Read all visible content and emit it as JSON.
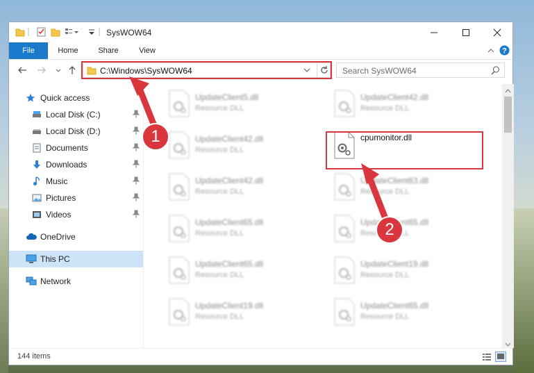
{
  "window": {
    "title": "SysWOW64",
    "caption": {
      "minimize": "minimize",
      "maximize": "maximize",
      "close": "close"
    }
  },
  "ribbon": {
    "tabs": [
      {
        "label": "File",
        "active": true
      },
      {
        "label": "Home"
      },
      {
        "label": "Share"
      },
      {
        "label": "View"
      }
    ]
  },
  "nav": {
    "address": "C:\\Windows\\SysWOW64",
    "search_placeholder": "Search SysWOW64"
  },
  "sidebar": {
    "quick_access": "Quick access",
    "items": [
      {
        "label": "Local Disk (C:)",
        "icon": "drive-icon",
        "pinned": true
      },
      {
        "label": "Local Disk (D:)",
        "icon": "drive-icon",
        "pinned": true
      },
      {
        "label": "Documents",
        "icon": "documents-icon",
        "pinned": true
      },
      {
        "label": "Downloads",
        "icon": "downloads-icon",
        "pinned": true
      },
      {
        "label": "Music",
        "icon": "music-icon",
        "pinned": true
      },
      {
        "label": "Pictures",
        "icon": "pictures-icon",
        "pinned": true
      },
      {
        "label": "Videos",
        "icon": "videos-icon",
        "pinned": true
      }
    ],
    "onedrive": "OneDrive",
    "this_pc": "This PC",
    "network": "Network"
  },
  "files": [
    {
      "name": "UpdateClient5.dll",
      "type": "Resource DLL",
      "blurred": true
    },
    {
      "name": "UpdateClient42.dll",
      "type": "Resource DLL",
      "blurred": true
    },
    {
      "name": "UpdateClient42.dll",
      "type": "Resource DLL",
      "blurred": true
    },
    {
      "name": "cpumonitor.dll",
      "type": "",
      "blurred": false
    },
    {
      "name": "UpdateClient42.dll",
      "type": "Resource DLL",
      "blurred": true
    },
    {
      "name": "UpdateClient63.dll",
      "type": "Resource DLL",
      "blurred": true
    },
    {
      "name": "UpdateClient65.dll",
      "type": "Resource DLL",
      "blurred": true
    },
    {
      "name": "UpdateClient65.dll",
      "type": "Resource DLL",
      "blurred": true
    },
    {
      "name": "UpdateClient65.dll",
      "type": "Resource DLL",
      "blurred": true
    },
    {
      "name": "UpdateClient19.dll",
      "type": "Resource DLL",
      "blurred": true
    },
    {
      "name": "UpdateClient19.dll",
      "type": "Resource DLL",
      "blurred": true
    },
    {
      "name": "UpdateClient65.dll",
      "type": "Resource DLL",
      "blurred": true
    }
  ],
  "status": {
    "item_count": "144 items"
  },
  "annotations": {
    "step1": "1",
    "step2": "2",
    "color": "#d9363e"
  },
  "colors": {
    "accent": "#1979ca",
    "selected": "#cde3f7"
  }
}
